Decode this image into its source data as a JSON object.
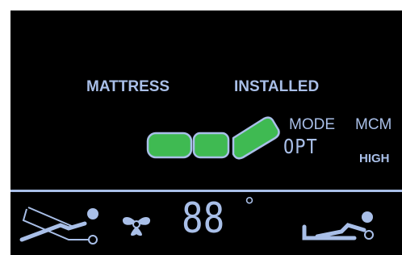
{
  "top_row": {
    "left_label": "MATTRESS",
    "right_label": "INSTALLED"
  },
  "mode": {
    "label": "MODE",
    "value": "MCM",
    "option": "OPT",
    "level": "HIGH"
  },
  "status_bar": {
    "temperature_digits": "88",
    "degree_symbol": "°"
  },
  "icons": {
    "bed": "bed-sections-icon",
    "bed_tilt": "bed-tilt-person-icon",
    "fan": "fan-icon",
    "reclining": "reclining-person-icon"
  },
  "colors": {
    "background": "#000000",
    "accent": "#a9bfe8",
    "bed_fill": "#3fba52"
  }
}
